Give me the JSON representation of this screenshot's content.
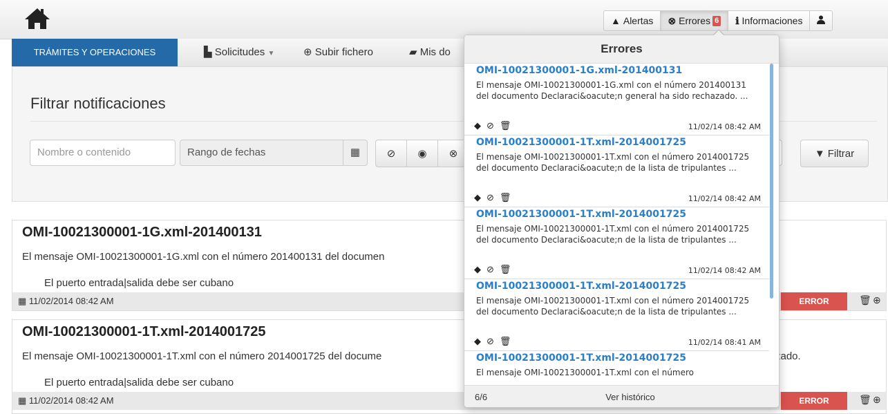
{
  "topbar": {
    "home_icon": "home-icon",
    "alertas_label": "Alertas",
    "errores_label": "Errores",
    "errores_count": "6",
    "informaciones_label": "Informaciones",
    "user_icon": "user-icon"
  },
  "nav": {
    "brand": "TRÁMITES Y OPERACIONES",
    "solicitudes": "Solicitudes",
    "subir": "Subir fichero",
    "mis": "Mis do"
  },
  "filter": {
    "title": "Filtrar notificaciones",
    "search_placeholder": "Nombre o contenido",
    "date_range_placeholder": "Rango de fechas",
    "filtrar_label": "Filtrar"
  },
  "cards": [
    {
      "title": "OMI-10021300001-1G.xml-201400131",
      "message": "El mensaje OMI-10021300001-1G.xml con el número 201400131 del documen",
      "detail": "El puerto entrada|salida debe ser cubano",
      "date": "11/02/2014 08:42 AM",
      "status": "ERROR"
    },
    {
      "title": "OMI-10021300001-1T.xml-2014001725",
      "message": "El mensaje OMI-10021300001-1T.xml con el número 2014001725 del docume",
      "message_tail": "zado.",
      "detail": "El puerto entrada|salida debe ser cubano",
      "date": "11/02/2014 08:42 AM",
      "status": "ERROR"
    }
  ],
  "errors_popover": {
    "title": "Errores",
    "items": [
      {
        "title": "OMI-10021300001-1G.xml-201400131",
        "message": "El mensaje OMI-10021300001-1G.xml con el número 201400131 del documento Declaraci&oacute;n general ha sido rechazado. ...",
        "date": "11/02/14 08:42 AM"
      },
      {
        "title": "OMI-10021300001-1T.xml-2014001725",
        "message": "El mensaje OMI-10021300001-1T.xml con el número 2014001725 del documento Declaraci&oacute;n de la lista de tripulantes ...",
        "date": "11/02/14 08:42 AM"
      },
      {
        "title": "OMI-10021300001-1T.xml-2014001725",
        "message": "El mensaje OMI-10021300001-1T.xml con el número 2014001725 del documento Declaraci&oacute;n de la lista de tripulantes ...",
        "date": "11/02/14 08:42 AM"
      },
      {
        "title": "OMI-10021300001-1T.xml-2014001725",
        "message": "El mensaje OMI-10021300001-1T.xml con el número 2014001725 del documento Declaraci&oacute;n de la lista de tripulantes ...",
        "date": "11/02/14 08:41 AM"
      },
      {
        "title": "OMI-10021300001-1T.xml-2014001725",
        "message": "El mensaje OMI-10021300001-1T.xml con el número",
        "date": ""
      }
    ],
    "count": "6/6",
    "history_link": "Ver histórico"
  },
  "colors": {
    "brand_blue": "#2469a8",
    "error_red": "#d9534f",
    "link_blue": "#2a7fc6"
  }
}
